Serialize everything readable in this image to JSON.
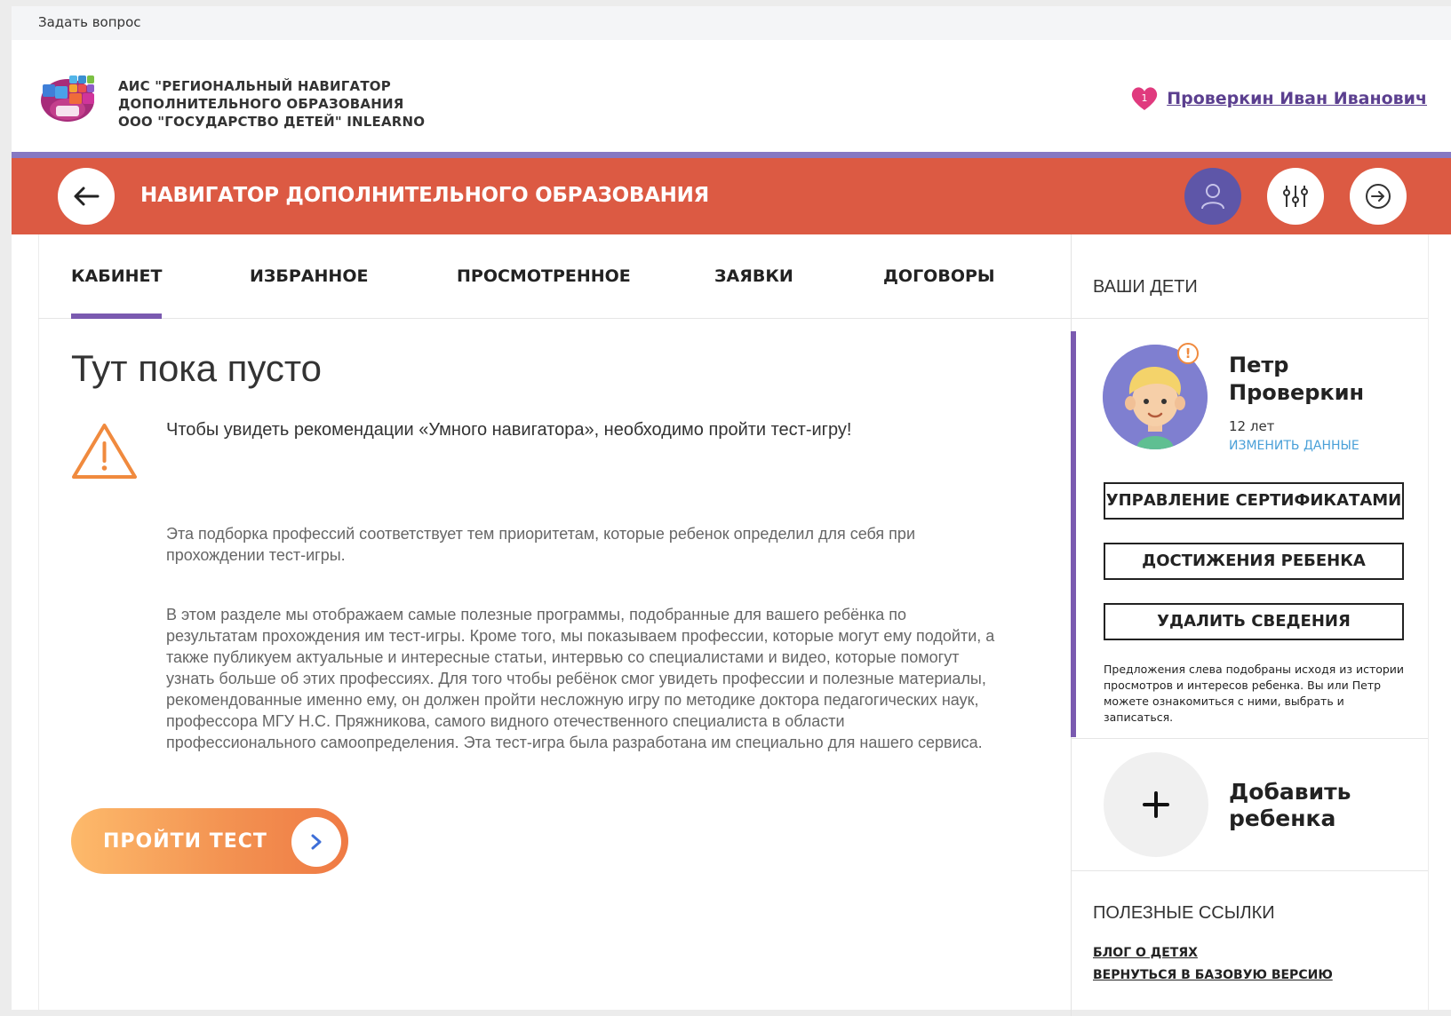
{
  "top": {
    "ask_question": "Задать вопрос"
  },
  "header": {
    "logo_line1": "АИС \"РЕГИОНАЛЬНЫЙ НАВИГАТОР",
    "logo_line2": "ДОПОЛНИТЕЛЬНОГО ОБРАЗОВАНИЯ",
    "logo_line3": "ООО \"ГОСУДАРСТВО ДЕТЕЙ\" INLEARNO",
    "favorites_count": "1",
    "user_name": "Проверкин Иван Иванович"
  },
  "navbar": {
    "title": "НАВИГАТОР ДОПОЛНИТЕЛЬНОГО ОБРАЗОВАНИЯ"
  },
  "tabs": [
    {
      "label": "КАБИНЕТ",
      "active": true
    },
    {
      "label": "ИЗБРАННОЕ",
      "active": false
    },
    {
      "label": "ПРОСМОТРЕННОЕ",
      "active": false
    },
    {
      "label": "ЗАЯВКИ",
      "active": false
    },
    {
      "label": "ДОГОВОРЫ",
      "active": false
    }
  ],
  "main": {
    "empty_title": "Тут пока пусто",
    "warning_text": "Чтобы увидеть рекомендации «Умного навигатора», необходимо пройти тест-игру!",
    "paragraph1": "Эта подборка профессий соответствует тем приоритетам, которые ребенок определил для себя при прохождении тест-игры.",
    "paragraph2": "В этом разделе мы отображаем самые полезные программы, подобранные для вашего ребёнка по результатам прохождения им тест-игры. Кроме того, мы показываем профессии, которые могут ему подойти, а также публикуем актуальные и интересные статьи, интервью со специалистами и видео, которые помогут узнать больше об этих профессиях. Для того чтобы ребёнок смог увидеть профессии и полезные материалы, рекомендованные именно ему, он должен пройти несложную игру по методике доктора педагогических наук, профессора МГУ Н.С. Пряжникова, самого видного отечественного специалиста в области профессионального самоопределения. Эта тест-игра была разработана им специально для нашего сервиса.",
    "test_button": "ПРОЙТИ ТЕСТ"
  },
  "sidebar": {
    "kids_title": "ВАШИ ДЕТИ",
    "child": {
      "first_name": "Петр",
      "last_name": "Проверкин",
      "age": "12 лет",
      "edit_link": "ИЗМЕНИТЬ ДАННЫЕ",
      "alert": "!"
    },
    "buttons": {
      "certificates": "УПРАВЛЕНИЕ СЕРТИФИКАТАМИ",
      "achievements": "ДОСТИЖЕНИЯ РЕБЕНКА",
      "delete": "УДАЛИТЬ СВЕДЕНИЯ"
    },
    "note": "Предложения слева подобраны исходя из истории просмотров и интересов ребенка. Вы или Петр можете ознакомиться с ними, выбрать и записаться.",
    "add_child": "Добавить ребенка",
    "links_title": "ПОЛЕЗНЫЕ ССЫЛКИ",
    "links": [
      "БЛОГ О ДЕТЯХ",
      "ВЕРНУТЬСЯ В БАЗОВУЮ ВЕРСИЮ"
    ]
  },
  "colors": {
    "navbar": "#dc5a43",
    "accent_purple": "#7a5ab0",
    "test_button_orange": "#f39352",
    "user_link": "#5b3f8f"
  },
  "icons": [
    "back-arrow-icon",
    "profile-icon",
    "filters-icon",
    "logout-icon",
    "heart-icon",
    "warning-icon",
    "chevron-right-icon",
    "plus-icon"
  ]
}
